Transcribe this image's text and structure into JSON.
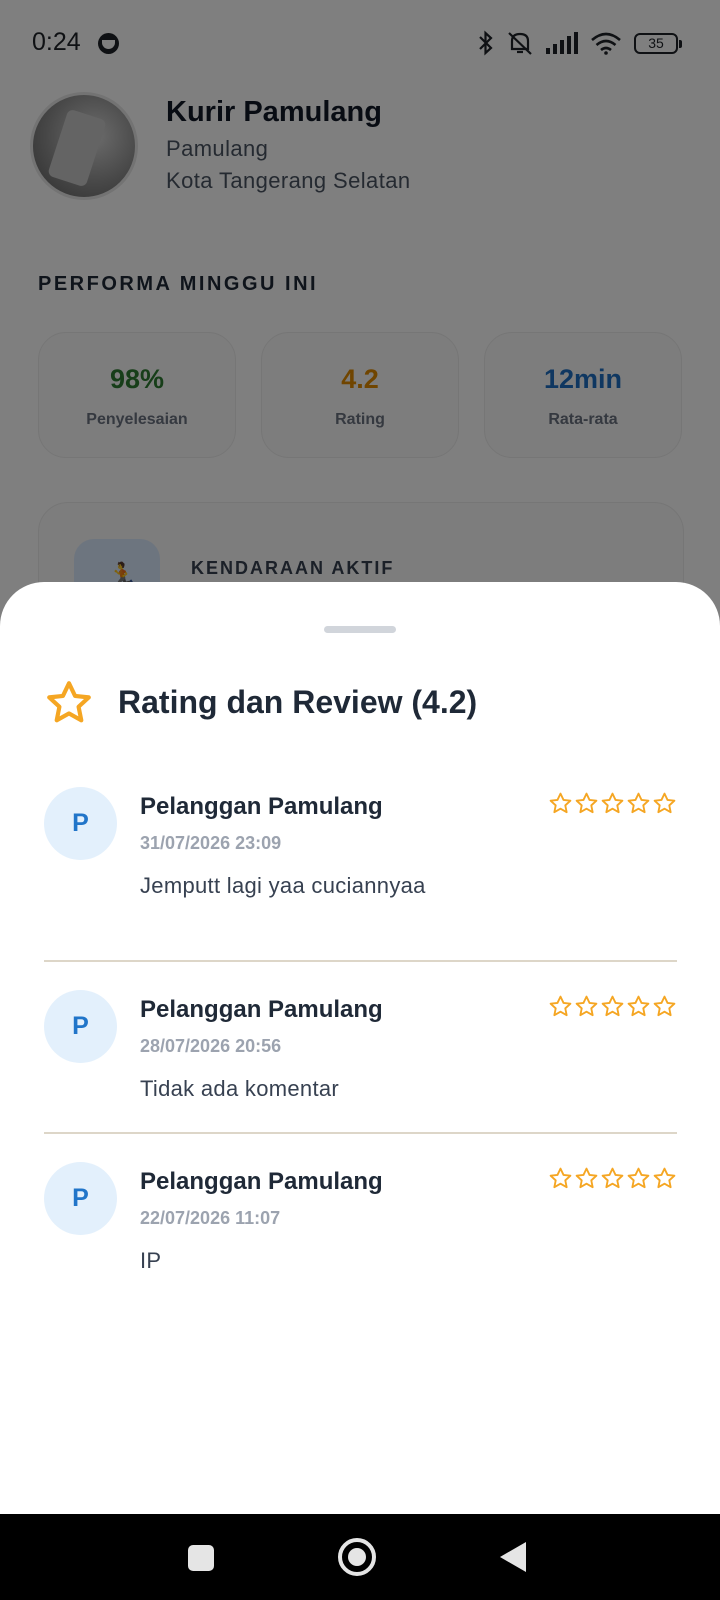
{
  "status_bar": {
    "time": "0:24",
    "battery": "35"
  },
  "profile": {
    "name": "Kurir Pamulang",
    "area": "Pamulang",
    "city": "Kota Tangerang Selatan"
  },
  "performance": {
    "heading": "PERFORMA MINGGU INI",
    "cards": [
      {
        "value": "98%",
        "label": "Penyelesaian",
        "color": "#2e7d32"
      },
      {
        "value": "4.2",
        "label": "Rating",
        "color": "#e08a00"
      },
      {
        "value": "12min",
        "label": "Rata-rata",
        "color": "#1e6fc2"
      }
    ]
  },
  "vehicle": {
    "label": "KENDARAAN AKTIF",
    "icon": "person-running-icon"
  },
  "sheet": {
    "title": "Rating dan Review (4.2)",
    "title_icon": "star-outline-icon",
    "star_color": "#f5a623",
    "reviews": [
      {
        "avatar_letter": "P",
        "name": "Pelanggan Pamulang",
        "date": "31/07/2026 23:09",
        "comment": "Jemputt lagi yaa cuciannyaa",
        "stars_filled": 0
      },
      {
        "avatar_letter": "P",
        "name": "Pelanggan Pamulang",
        "date": "28/07/2026 20:56",
        "comment": "Tidak ada komentar",
        "stars_filled": 0
      },
      {
        "avatar_letter": "P",
        "name": "Pelanggan Pamulang",
        "date": "22/07/2026 11:07",
        "comment": "IP",
        "stars_filled": 0
      }
    ]
  },
  "nav_bar": {
    "buttons": [
      "recents-icon",
      "home-icon",
      "back-icon"
    ]
  }
}
